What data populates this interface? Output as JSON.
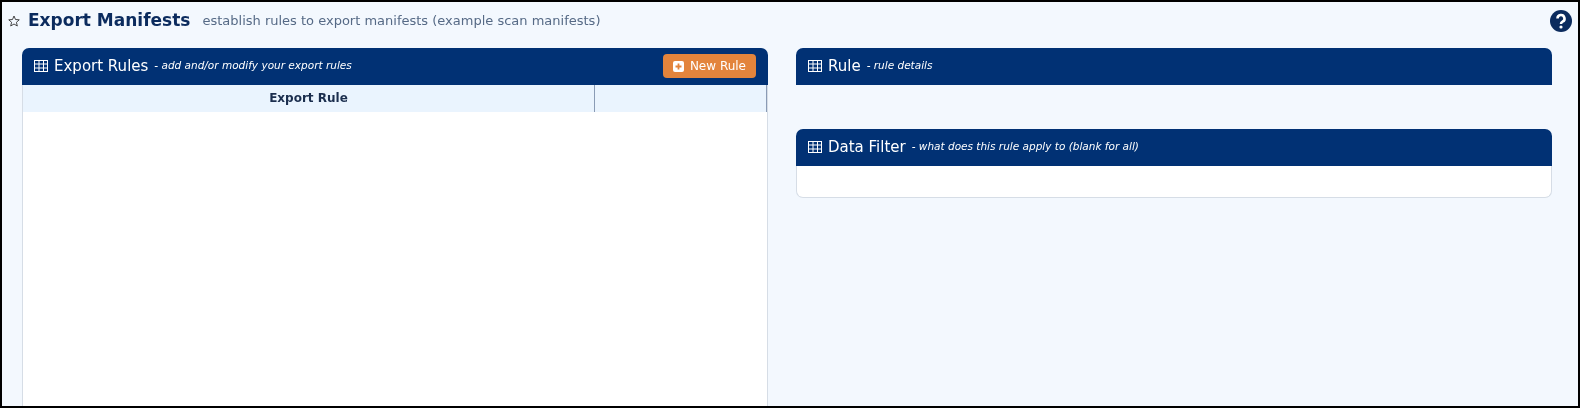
{
  "page": {
    "title": "Export Manifests",
    "subtitle": "establish rules to export manifests (example scan manifests)",
    "favorite": false
  },
  "export_rules": {
    "title": "Export Rules",
    "subtitle": "- add and/or modify your export rules",
    "button": "New Rule",
    "columns": [
      "Export Rule"
    ]
  },
  "rule": {
    "title": "Rule",
    "subtitle": "- rule details"
  },
  "data_filter": {
    "title": "Data Filter",
    "subtitle": "- what does this rule apply to (blank for all)"
  }
}
